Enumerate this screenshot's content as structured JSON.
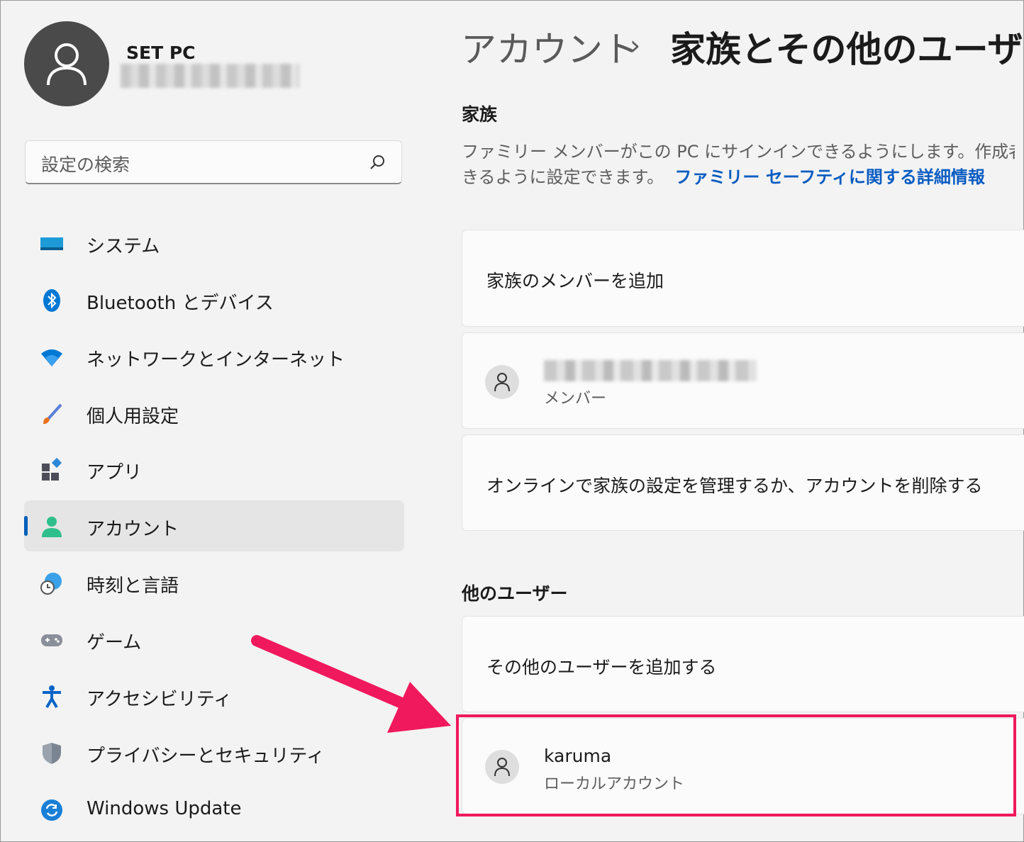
{
  "profile": {
    "name": "SET PC"
  },
  "search": {
    "placeholder": "設定の検索"
  },
  "nav": [
    {
      "label": "システム",
      "icon": "monitor-icon"
    },
    {
      "label": "Bluetooth とデバイス",
      "icon": "bluetooth-icon"
    },
    {
      "label": "ネットワークとインターネット",
      "icon": "wifi-icon"
    },
    {
      "label": "個人用設定",
      "icon": "brush-icon"
    },
    {
      "label": "アプリ",
      "icon": "apps-icon"
    },
    {
      "label": "アカウント",
      "icon": "account-icon",
      "active": true
    },
    {
      "label": "時刻と言語",
      "icon": "globe-clock-icon"
    },
    {
      "label": "ゲーム",
      "icon": "gamepad-icon"
    },
    {
      "label": "アクセシビリティ",
      "icon": "accessibility-icon"
    },
    {
      "label": "プライバシーとセキュリティ",
      "icon": "shield-icon"
    },
    {
      "label": "Windows Update",
      "icon": "update-icon"
    }
  ],
  "breadcrumb": {
    "parent": "アカウント",
    "separator": "›",
    "current": "家族とその他のユーザー"
  },
  "family": {
    "heading": "家族",
    "description_line1": "ファミリー メンバーがこの PC にサインインできるようにします。作成者は、安全",
    "description_line2": "きるように設定できます。",
    "link": "ファミリー セーフティに関する詳細情報",
    "add_member": "家族のメンバーを追加",
    "member_role": "メンバー",
    "manage_online": "オンラインで家族の設定を管理するか、アカウントを削除する"
  },
  "other_users": {
    "heading": "他のユーザー",
    "add_user": "その他のユーザーを追加する",
    "user_name": "karuma",
    "user_type": "ローカルアカウント"
  },
  "colors": {
    "accent": "#005fb8",
    "link": "#0a5cc2",
    "highlight": "#f0195d"
  }
}
